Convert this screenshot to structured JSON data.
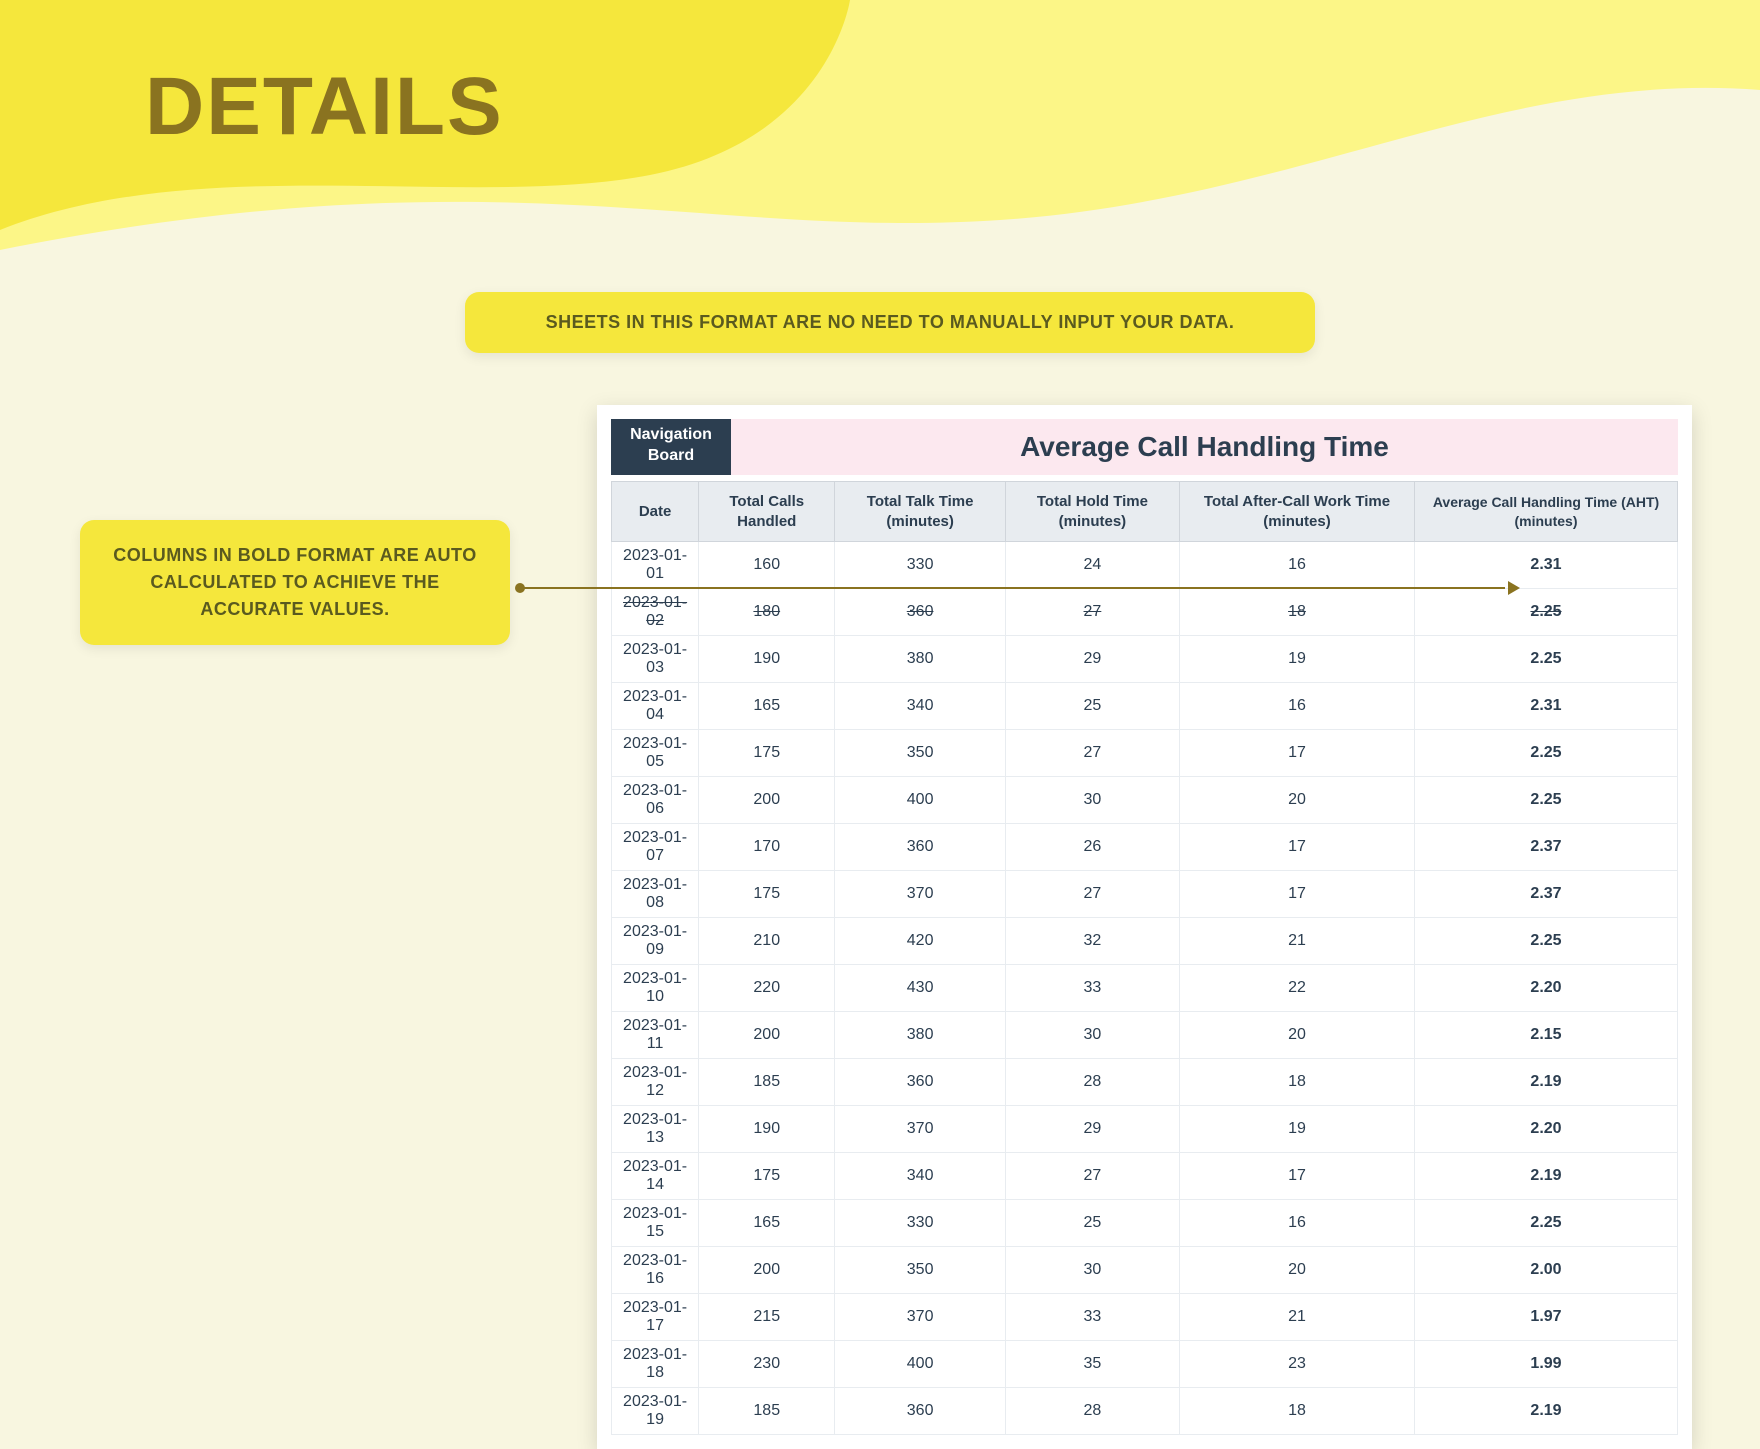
{
  "page": {
    "title": "DETAILS",
    "banner": "SHEETS IN THIS FORMAT ARE NO NEED TO MANUALLY INPUT YOUR DATA.",
    "callout": "COLUMNS IN BOLD FORMAT ARE AUTO CALCULATED TO ACHIEVE THE ACCURATE VALUES."
  },
  "sheet": {
    "nav_label": "Navigation Board",
    "title": "Average Call Handling Time",
    "columns": [
      "Date",
      "Total Calls Handled",
      "Total Talk Time (minutes)",
      "Total Hold Time (minutes)",
      "Total After-Call Work Time (minutes)",
      "Average Call Handling Time (AHT) (minutes)"
    ],
    "rows": [
      {
        "date": "2023-01-01",
        "calls": "160",
        "talk": "330",
        "hold": "24",
        "acw": "16",
        "aht": "2.31"
      },
      {
        "date": "2023-01-02",
        "calls": "180",
        "talk": "360",
        "hold": "27",
        "acw": "18",
        "aht": "2.25"
      },
      {
        "date": "2023-01-03",
        "calls": "190",
        "talk": "380",
        "hold": "29",
        "acw": "19",
        "aht": "2.25"
      },
      {
        "date": "2023-01-04",
        "calls": "165",
        "talk": "340",
        "hold": "25",
        "acw": "16",
        "aht": "2.31"
      },
      {
        "date": "2023-01-05",
        "calls": "175",
        "talk": "350",
        "hold": "27",
        "acw": "17",
        "aht": "2.25"
      },
      {
        "date": "2023-01-06",
        "calls": "200",
        "talk": "400",
        "hold": "30",
        "acw": "20",
        "aht": "2.25"
      },
      {
        "date": "2023-01-07",
        "calls": "170",
        "talk": "360",
        "hold": "26",
        "acw": "17",
        "aht": "2.37"
      },
      {
        "date": "2023-01-08",
        "calls": "175",
        "talk": "370",
        "hold": "27",
        "acw": "17",
        "aht": "2.37"
      },
      {
        "date": "2023-01-09",
        "calls": "210",
        "talk": "420",
        "hold": "32",
        "acw": "21",
        "aht": "2.25"
      },
      {
        "date": "2023-01-10",
        "calls": "220",
        "talk": "430",
        "hold": "33",
        "acw": "22",
        "aht": "2.20"
      },
      {
        "date": "2023-01-11",
        "calls": "200",
        "talk": "380",
        "hold": "30",
        "acw": "20",
        "aht": "2.15"
      },
      {
        "date": "2023-01-12",
        "calls": "185",
        "talk": "360",
        "hold": "28",
        "acw": "18",
        "aht": "2.19"
      },
      {
        "date": "2023-01-13",
        "calls": "190",
        "talk": "370",
        "hold": "29",
        "acw": "19",
        "aht": "2.20"
      },
      {
        "date": "2023-01-14",
        "calls": "175",
        "talk": "340",
        "hold": "27",
        "acw": "17",
        "aht": "2.19"
      },
      {
        "date": "2023-01-15",
        "calls": "165",
        "talk": "330",
        "hold": "25",
        "acw": "16",
        "aht": "2.25"
      },
      {
        "date": "2023-01-16",
        "calls": "200",
        "talk": "350",
        "hold": "30",
        "acw": "20",
        "aht": "2.00"
      },
      {
        "date": "2023-01-17",
        "calls": "215",
        "talk": "370",
        "hold": "33",
        "acw": "21",
        "aht": "1.97"
      },
      {
        "date": "2023-01-18",
        "calls": "230",
        "talk": "400",
        "hold": "35",
        "acw": "23",
        "aht": "1.99"
      },
      {
        "date": "2023-01-19",
        "calls": "185",
        "talk": "360",
        "hold": "28",
        "acw": "18",
        "aht": "2.19"
      }
    ]
  },
  "chart_data": {
    "type": "table",
    "title": "Average Call Handling Time",
    "columns": [
      "Date",
      "Total Calls Handled",
      "Total Talk Time (minutes)",
      "Total Hold Time (minutes)",
      "Total After-Call Work Time (minutes)",
      "Average Call Handling Time (AHT) (minutes)"
    ],
    "rows": [
      [
        "2023-01-01",
        160,
        330,
        24,
        16,
        2.31
      ],
      [
        "2023-01-02",
        180,
        360,
        27,
        18,
        2.25
      ],
      [
        "2023-01-03",
        190,
        380,
        29,
        19,
        2.25
      ],
      [
        "2023-01-04",
        165,
        340,
        25,
        16,
        2.31
      ],
      [
        "2023-01-05",
        175,
        350,
        27,
        17,
        2.25
      ],
      [
        "2023-01-06",
        200,
        400,
        30,
        20,
        2.25
      ],
      [
        "2023-01-07",
        170,
        360,
        26,
        17,
        2.37
      ],
      [
        "2023-01-08",
        175,
        370,
        27,
        17,
        2.37
      ],
      [
        "2023-01-09",
        210,
        420,
        32,
        21,
        2.25
      ],
      [
        "2023-01-10",
        220,
        430,
        33,
        22,
        2.2
      ],
      [
        "2023-01-11",
        200,
        380,
        30,
        20,
        2.15
      ],
      [
        "2023-01-12",
        185,
        360,
        28,
        18,
        2.19
      ],
      [
        "2023-01-13",
        190,
        370,
        29,
        19,
        2.2
      ],
      [
        "2023-01-14",
        175,
        340,
        27,
        17,
        2.19
      ],
      [
        "2023-01-15",
        165,
        330,
        25,
        16,
        2.25
      ],
      [
        "2023-01-16",
        200,
        350,
        30,
        20,
        2.0
      ],
      [
        "2023-01-17",
        215,
        370,
        33,
        21,
        1.97
      ],
      [
        "2023-01-18",
        230,
        400,
        35,
        23,
        1.99
      ],
      [
        "2023-01-19",
        185,
        360,
        28,
        18,
        2.19
      ]
    ]
  }
}
